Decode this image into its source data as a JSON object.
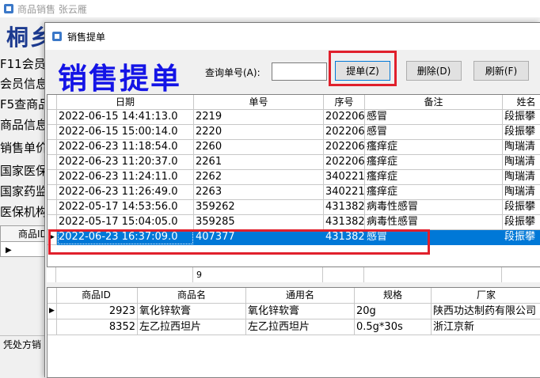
{
  "main_window": {
    "title": "商品销售 张云雁",
    "brand": "桐乡",
    "menu_items": [
      "F11会员",
      "会员信息",
      "F5查商品",
      "商品信息",
      "销售单价",
      "国家医保",
      "国家药监",
      "医保机构"
    ],
    "grid_header": "商品ID",
    "bottom_label": "凭处方销"
  },
  "dialog": {
    "title": "销售提单",
    "big_title": "销售提单",
    "query_label": "查询单号(A):",
    "query_value": "",
    "buttons": {
      "submit": "提单(Z)",
      "delete": "删除(D)",
      "refresh": "刷新(F)"
    }
  },
  "orders": {
    "columns": [
      "日期",
      "单号",
      "序号",
      "备注",
      "姓名"
    ],
    "rows": [
      {
        "date": "2022-06-15 14:41:13.0",
        "no": "2219",
        "seq": "202206",
        "remark": "感冒",
        "name": "段振攀"
      },
      {
        "date": "2022-06-15 15:00:14.0",
        "no": "2220",
        "seq": "202206",
        "remark": "感冒",
        "name": "段振攀"
      },
      {
        "date": "2022-06-23 11:18:54.0",
        "no": "2260",
        "seq": "202206",
        "remark": "瘙痒症",
        "name": "陶瑞清"
      },
      {
        "date": "2022-06-23 11:20:37.0",
        "no": "2261",
        "seq": "202206",
        "remark": "瘙痒症",
        "name": "陶瑞清"
      },
      {
        "date": "2022-06-23 11:24:11.0",
        "no": "2262",
        "seq": "340221",
        "remark": "瘙痒症",
        "name": "陶瑞清"
      },
      {
        "date": "2022-06-23 11:26:49.0",
        "no": "2263",
        "seq": "340221",
        "remark": "瘙痒症",
        "name": "陶瑞清"
      },
      {
        "date": "2022-05-17 14:53:56.0",
        "no": "359262",
        "seq": "431382",
        "remark": "病毒性感冒",
        "name": "段振攀"
      },
      {
        "date": "2022-05-17 15:04:05.0",
        "no": "359285",
        "seq": "431382",
        "remark": "病毒性感冒",
        "name": "段振攀"
      },
      {
        "date": "2022-06-23 16:37:09.0",
        "no": "407377",
        "seq": "431382",
        "remark": "感冒",
        "name": "段振攀"
      }
    ],
    "selected_index": 8,
    "footer_count": "9"
  },
  "items": {
    "columns": [
      "商品ID",
      "商品名",
      "通用名",
      "规格",
      "厂家"
    ],
    "rows": [
      {
        "id": "2923",
        "pname": "氧化锌软膏",
        "gname": "氧化锌软膏",
        "spec": "20g",
        "maker": "陕西功达制药有限公司"
      },
      {
        "id": "8352",
        "pname": "左乙拉西坦片",
        "gname": "左乙拉西坦片",
        "spec": "0.5g*30s",
        "maker": "浙江京新"
      }
    ]
  },
  "colors": {
    "title_blue": "#1414e6",
    "selection_blue": "#0078d7",
    "highlight_red": "#e0202c",
    "brand_blue": "#1c3a8f"
  },
  "icons": {
    "app": "app-icon",
    "row_pointer": "row-pointer-icon"
  }
}
